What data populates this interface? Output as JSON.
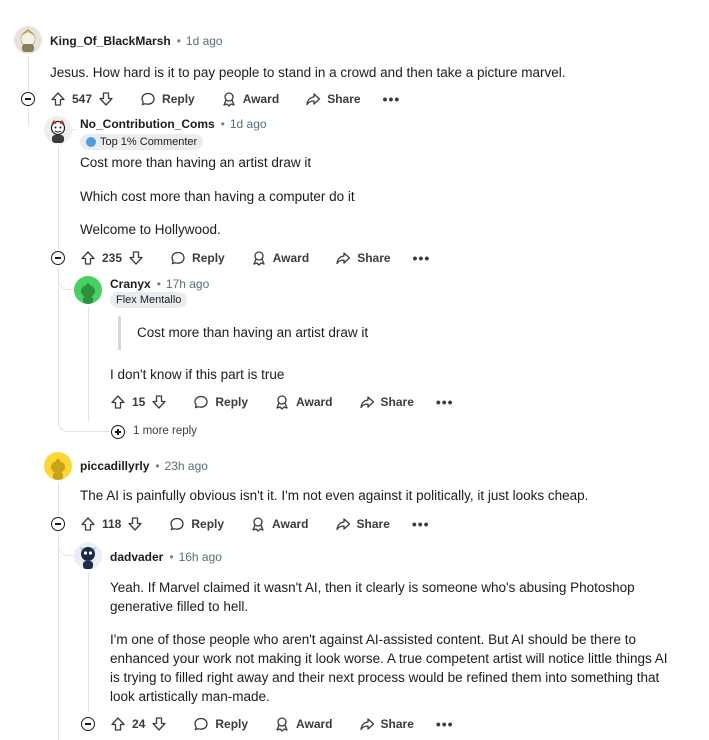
{
  "comments": {
    "c1": {
      "username": "King_Of_BlackMarsh",
      "time": "1d ago",
      "text": "Jesus. How hard is it to pay people to stand in a crowd and then take a picture marvel.",
      "score": "547",
      "reply": "Reply",
      "award": "Award",
      "share": "Share"
    },
    "c2": {
      "username": "No_Contribution_Coms",
      "time": "1d ago",
      "flair": "Top 1% Commenter",
      "lines": [
        "Cost more than having an artist draw it",
        "Which cost more than having a computer do it",
        "Welcome to Hollywood."
      ],
      "score": "235",
      "reply": "Reply",
      "award": "Award",
      "share": "Share"
    },
    "c3": {
      "username": "Cranyx",
      "time": "17h ago",
      "flair": "Flex Mentallo",
      "quote": "Cost more than having an artist draw it",
      "text": "I don't know if this part is true",
      "score": "15",
      "reply": "Reply",
      "award": "Award",
      "share": "Share",
      "more_replies": "1 more reply"
    },
    "c4": {
      "username": "piccadillyrly",
      "time": "23h ago",
      "text": "The AI is painfully obvious isn't it. I'm not even against it politically, it just looks cheap.",
      "score": "118",
      "reply": "Reply",
      "award": "Award",
      "share": "Share"
    },
    "c5": {
      "username": "dadvader",
      "time": "16h ago",
      "p1": [
        "Yeah. If Marvel claimed it wasn't AI, then it clearly is someone who's abusing Photoshop",
        "generative filled to hell."
      ],
      "p2": [
        "I'm one of those people who aren't against AI-assisted content. But AI should be there to",
        "enhanced your work not making it look worse. A true competent artist will notice little things AI",
        "is trying to filled right away and their next process would be refined them into something that",
        "look artistically man-made."
      ],
      "score": "24",
      "reply": "Reply",
      "award": "Award",
      "share": "Share"
    }
  },
  "separator": "•",
  "icons": [
    "upvote-icon",
    "downvote-icon",
    "reply-icon",
    "award-icon",
    "share-icon",
    "more-icon",
    "collapse-icon",
    "expand-icon"
  ],
  "colors": {
    "thread_line": "#e0e4e6",
    "flair_bg": "#eaedef",
    "text": "#1c1c1c",
    "meta": "#576f76"
  }
}
